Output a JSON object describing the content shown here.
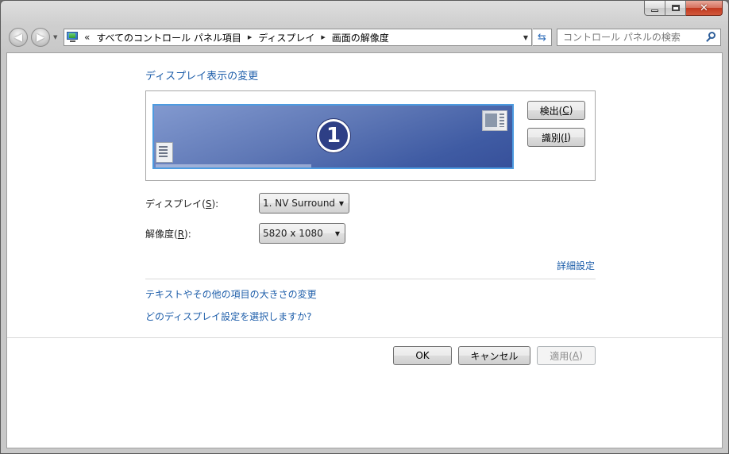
{
  "window": {
    "minimize_label": "Minimize",
    "maximize_label": "Maximize",
    "close_label": "✕"
  },
  "navigation": {
    "back_glyph": "◀",
    "forward_glyph": "▶",
    "overflow_chevron": "«",
    "breadcrumbs": [
      "すべてのコントロール パネル項目",
      "ディスプレイ",
      "画面の解像度"
    ],
    "search_placeholder": "コントロール パネルの検索"
  },
  "main": {
    "heading": "ディスプレイ表示の変更",
    "monitor_number": "1",
    "detect_button": {
      "label": "検出(",
      "mnemonic": "C",
      "suffix": ")"
    },
    "identify_button": {
      "label": "識別(",
      "mnemonic": "I",
      "suffix": ")"
    },
    "display_field": {
      "label": "ディスプレイ(",
      "mnemonic": "S",
      "suffix": "):",
      "value": "1. NV Surround"
    },
    "resolution_field": {
      "label": "解像度(",
      "mnemonic": "R",
      "suffix": "):",
      "value": "5820 x 1080"
    },
    "advanced_link": "詳細設定",
    "text_size_link": "テキストやその他の項目の大きさの変更",
    "which_settings_link": "どのディスプレイ設定を選択しますか?"
  },
  "footer": {
    "ok_label": "OK",
    "cancel_label": "キャンセル",
    "apply_button": {
      "label": "適用(",
      "mnemonic": "A",
      "suffix": ")",
      "enabled": false
    }
  },
  "colors": {
    "link": "#1e5eaa",
    "monitor_border": "#4d9be0",
    "monitor_fill": "#5f78b6"
  }
}
